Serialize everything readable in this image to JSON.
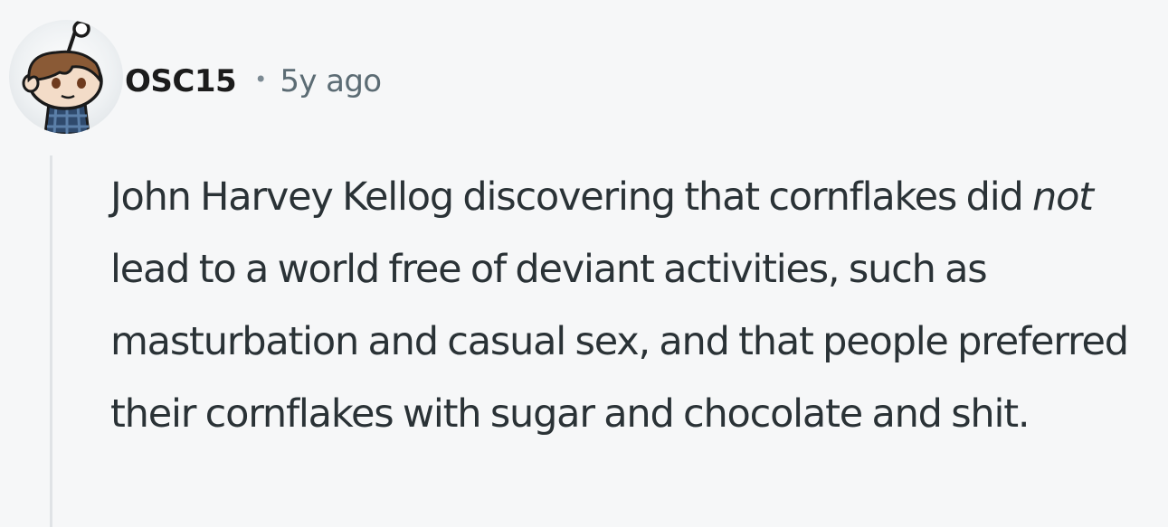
{
  "comment": {
    "username": "OSC15",
    "separator": "•",
    "timestamp": "5y ago",
    "body": {
      "before_emphasis": "John Harvey Kellog discovering that cornflakes did ",
      "emphasis": "not",
      "after_emphasis": " lead to a world free of deviant activities, such as masturbation and casual sex, and that people preferred their cornflakes with sugar and chocolate and shit."
    },
    "avatar_icon": "snoo-avatar-icon"
  },
  "colors": {
    "background": "#f6f7f8",
    "username": "#1c1c1c",
    "timestamp": "#5c6c74",
    "body_text": "#2a3236",
    "thread_line": "#e0e3e6"
  }
}
